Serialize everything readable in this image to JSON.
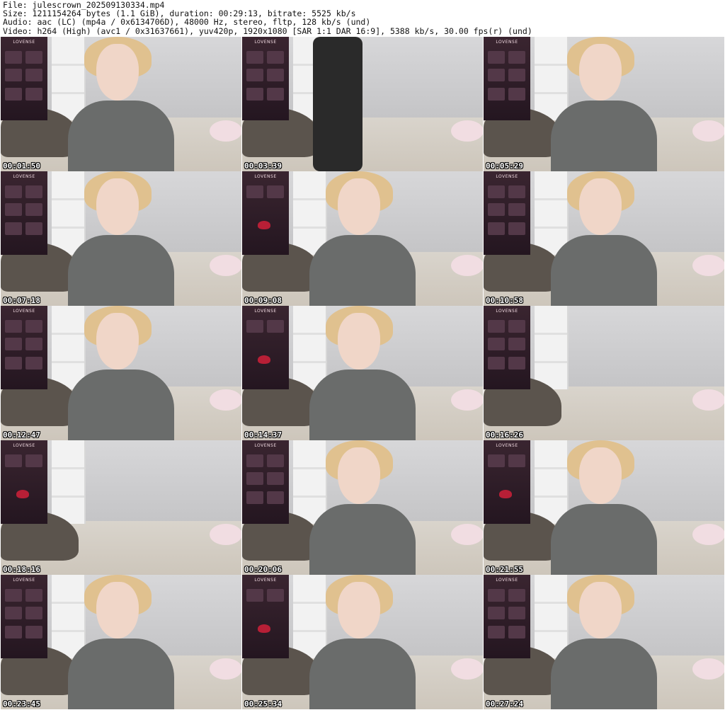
{
  "header": {
    "line1": "File: julescrown_202509130334.mp4",
    "line2": "Size: 1211154264 bytes (1.1 GiB), duration: 00:29:13, bitrate: 5525 kb/s",
    "line3": "Audio: aac (LC) (mp4a / 0x6134706D), 48000 Hz, stereo, fltp, 128 kb/s (und)",
    "line4": "Video: h264 (High) (avc1 / 0x31637661), yuv420p, 1920x1080 [SAR 1:1 DAR 16:9], 5388 kb/s, 30.00 fps(r) (und)"
  },
  "overlay_brand": "LOVENSE",
  "thumbnails": [
    {
      "timestamp": "00:01:50"
    },
    {
      "timestamp": "00:03:39"
    },
    {
      "timestamp": "00:05:29"
    },
    {
      "timestamp": "00:07:18"
    },
    {
      "timestamp": "00:09:08"
    },
    {
      "timestamp": "00:10:58"
    },
    {
      "timestamp": "00:12:47"
    },
    {
      "timestamp": "00:14:37"
    },
    {
      "timestamp": "00:16:26"
    },
    {
      "timestamp": "00:18:16"
    },
    {
      "timestamp": "00:20:06"
    },
    {
      "timestamp": "00:21:55"
    },
    {
      "timestamp": "00:23:45"
    },
    {
      "timestamp": "00:25:34"
    },
    {
      "timestamp": "00:27:24"
    }
  ]
}
